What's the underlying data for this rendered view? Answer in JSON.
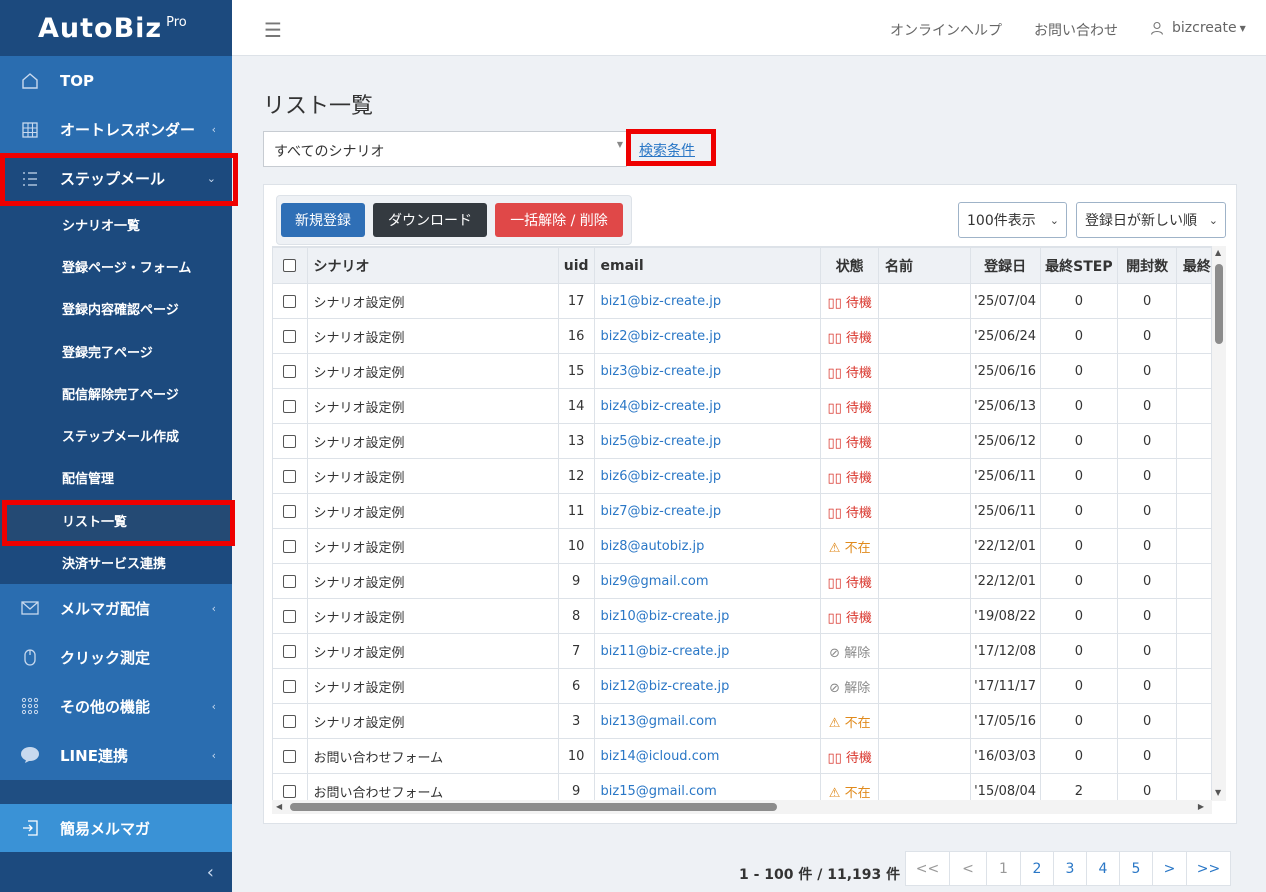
{
  "app": {
    "logo_main": "AutoBiz",
    "logo_sup": "Pro"
  },
  "sidebar": {
    "items": [
      {
        "label": "TOP",
        "icon": "home-icon"
      },
      {
        "label": "オートレスポンダー",
        "icon": "grid-icon",
        "arrow": "‹"
      },
      {
        "label": "ステップメール",
        "icon": "list-icon",
        "arrow": "⌄"
      }
    ],
    "sub_items": [
      "シナリオ一覧",
      "登録ページ・フォーム",
      "登録内容確認ページ",
      "登録完了ページ",
      "配信解除完了ページ",
      "ステップメール作成",
      "配信管理",
      "リスト一覧",
      "決済サービス連携"
    ],
    "items_after": [
      {
        "label": "メルマガ配信",
        "icon": "mail-icon",
        "arrow": "‹"
      },
      {
        "label": "クリック測定",
        "icon": "mouse-icon",
        "arrow": ""
      },
      {
        "label": "その他の機能",
        "icon": "apps-icon",
        "arrow": "‹"
      },
      {
        "label": "LINE連携",
        "icon": "line-icon",
        "arrow": "‹"
      }
    ],
    "simple_label": "簡易メルマガ",
    "collapse": "‹"
  },
  "topbar": {
    "help": "オンラインヘルプ",
    "contact": "お問い合わせ",
    "user": "bizcreate"
  },
  "main": {
    "title": "リスト一覧",
    "scenario_select": "すべてのシナリオ",
    "search_link": "検索条件",
    "buttons": {
      "new": "新規登録",
      "download": "ダウンロード",
      "bulk": "一括解除 / 削除"
    },
    "per_page": "100件表示",
    "sort": "登録日が新しい順"
  },
  "table": {
    "columns": [
      "シナリオ",
      "uid",
      "email",
      "状態",
      "名前",
      "登録日",
      "最終STEP",
      "開封数",
      "最終"
    ],
    "rows": [
      {
        "scenario": "シナリオ設定例",
        "uid": "17",
        "email": "biz1@biz-create.jp",
        "status": "待機",
        "status_type": "wait",
        "name": "",
        "date": "'25/07/04",
        "step": "0",
        "opens": "0"
      },
      {
        "scenario": "シナリオ設定例",
        "uid": "16",
        "email": "biz2@biz-create.jp",
        "status": "待機",
        "status_type": "wait",
        "name": "",
        "date": "'25/06/24",
        "step": "0",
        "opens": "0"
      },
      {
        "scenario": "シナリオ設定例",
        "uid": "15",
        "email": "biz3@biz-create.jp",
        "status": "待機",
        "status_type": "wait",
        "name": "",
        "date": "'25/06/16",
        "step": "0",
        "opens": "0"
      },
      {
        "scenario": "シナリオ設定例",
        "uid": "14",
        "email": "biz4@biz-create.jp",
        "status": "待機",
        "status_type": "wait",
        "name": "",
        "date": "'25/06/13",
        "step": "0",
        "opens": "0"
      },
      {
        "scenario": "シナリオ設定例",
        "uid": "13",
        "email": "biz5@biz-create.jp",
        "status": "待機",
        "status_type": "wait",
        "name": "",
        "date": "'25/06/12",
        "step": "0",
        "opens": "0"
      },
      {
        "scenario": "シナリオ設定例",
        "uid": "12",
        "email": "biz6@biz-create.jp",
        "status": "待機",
        "status_type": "wait",
        "name": "",
        "date": "'25/06/11",
        "step": "0",
        "opens": "0"
      },
      {
        "scenario": "シナリオ設定例",
        "uid": "11",
        "email": "biz7@biz-create.jp",
        "status": "待機",
        "status_type": "wait",
        "name": "",
        "date": "'25/06/11",
        "step": "0",
        "opens": "0"
      },
      {
        "scenario": "シナリオ設定例",
        "uid": "10",
        "email": "biz8@autobiz.jp",
        "status": "不在",
        "status_type": "absent",
        "name": "",
        "date": "'22/12/01",
        "step": "0",
        "opens": "0"
      },
      {
        "scenario": "シナリオ設定例",
        "uid": "9",
        "email": "biz9@gmail.com",
        "status": "待機",
        "status_type": "wait",
        "name": "",
        "date": "'22/12/01",
        "step": "0",
        "opens": "0"
      },
      {
        "scenario": "シナリオ設定例",
        "uid": "8",
        "email": "biz10@biz-create.jp",
        "status": "待機",
        "status_type": "wait",
        "name": "",
        "date": "'19/08/22",
        "step": "0",
        "opens": "0"
      },
      {
        "scenario": "シナリオ設定例",
        "uid": "7",
        "email": "biz11@biz-create.jp",
        "status": "解除",
        "status_type": "cancel",
        "name": "",
        "date": "'17/12/08",
        "step": "0",
        "opens": "0"
      },
      {
        "scenario": "シナリオ設定例",
        "uid": "6",
        "email": "biz12@biz-create.jp",
        "status": "解除",
        "status_type": "cancel",
        "name": "",
        "date": "'17/11/17",
        "step": "0",
        "opens": "0"
      },
      {
        "scenario": "シナリオ設定例",
        "uid": "3",
        "email": "biz13@gmail.com",
        "status": "不在",
        "status_type": "absent",
        "name": "",
        "date": "'17/05/16",
        "step": "0",
        "opens": "0"
      },
      {
        "scenario": "お問い合わせフォーム",
        "uid": "10",
        "email": "biz14@icloud.com",
        "status": "待機",
        "status_type": "wait",
        "name": "",
        "date": "'16/03/03",
        "step": "0",
        "opens": "0"
      },
      {
        "scenario": "お問い合わせフォーム",
        "uid": "9",
        "email": "biz15@gmail.com",
        "status": "不在",
        "status_type": "absent",
        "name": "",
        "date": "'15/08/04",
        "step": "2",
        "opens": "0"
      }
    ]
  },
  "pagination": {
    "summary": "1 - 100 件 / 11,193 件",
    "items": [
      "<<",
      "<",
      "1",
      "2",
      "3",
      "4",
      "5",
      ">",
      ">>"
    ]
  },
  "colors": {
    "sidebar": "#1f4e82",
    "nav_blue": "#2a6db0",
    "primary": "#2a77c6",
    "danger": "#e04848",
    "dark": "#343a40",
    "highlight": "#ee0000"
  }
}
